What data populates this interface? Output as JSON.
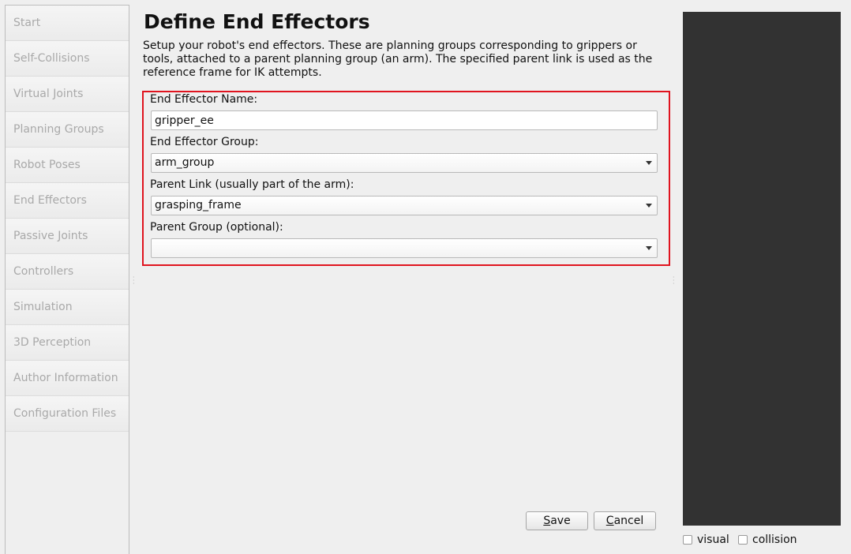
{
  "sidebar": {
    "items": [
      {
        "label": "Start"
      },
      {
        "label": "Self-Collisions"
      },
      {
        "label": "Virtual Joints"
      },
      {
        "label": "Planning Groups"
      },
      {
        "label": "Robot Poses"
      },
      {
        "label": "End Effectors"
      },
      {
        "label": "Passive Joints"
      },
      {
        "label": "Controllers"
      },
      {
        "label": "Simulation"
      },
      {
        "label": "3D Perception"
      },
      {
        "label": "Author Information"
      },
      {
        "label": "Configuration Files"
      }
    ]
  },
  "main": {
    "title": "Define End Effectors",
    "description": "Setup your robot's end effectors. These are planning groups corresponding to grippers or tools, attached to a parent planning group (an arm). The specified parent link is used as the reference frame for IK attempts.",
    "form": {
      "name_label": "End Effector Name:",
      "name_value": "gripper_ee",
      "group_label": "End Effector Group:",
      "group_value": "arm_group",
      "parent_link_label": "Parent Link (usually part of the arm):",
      "parent_link_value": "grasping_frame",
      "parent_group_label": "Parent Group (optional):",
      "parent_group_value": ""
    },
    "buttons": {
      "save_label": "Save",
      "save_mnemonic": "S",
      "save_rest": "ave",
      "cancel_mnemonic": "C",
      "cancel_rest": "ancel"
    }
  },
  "viewer": {
    "visual_label": "visual",
    "collision_label": "collision",
    "visual_checked": false,
    "collision_checked": false,
    "background_color": "#323232"
  },
  "colors": {
    "highlight_border": "#e0141f",
    "inactive_nav_text": "#a9a9a9"
  }
}
